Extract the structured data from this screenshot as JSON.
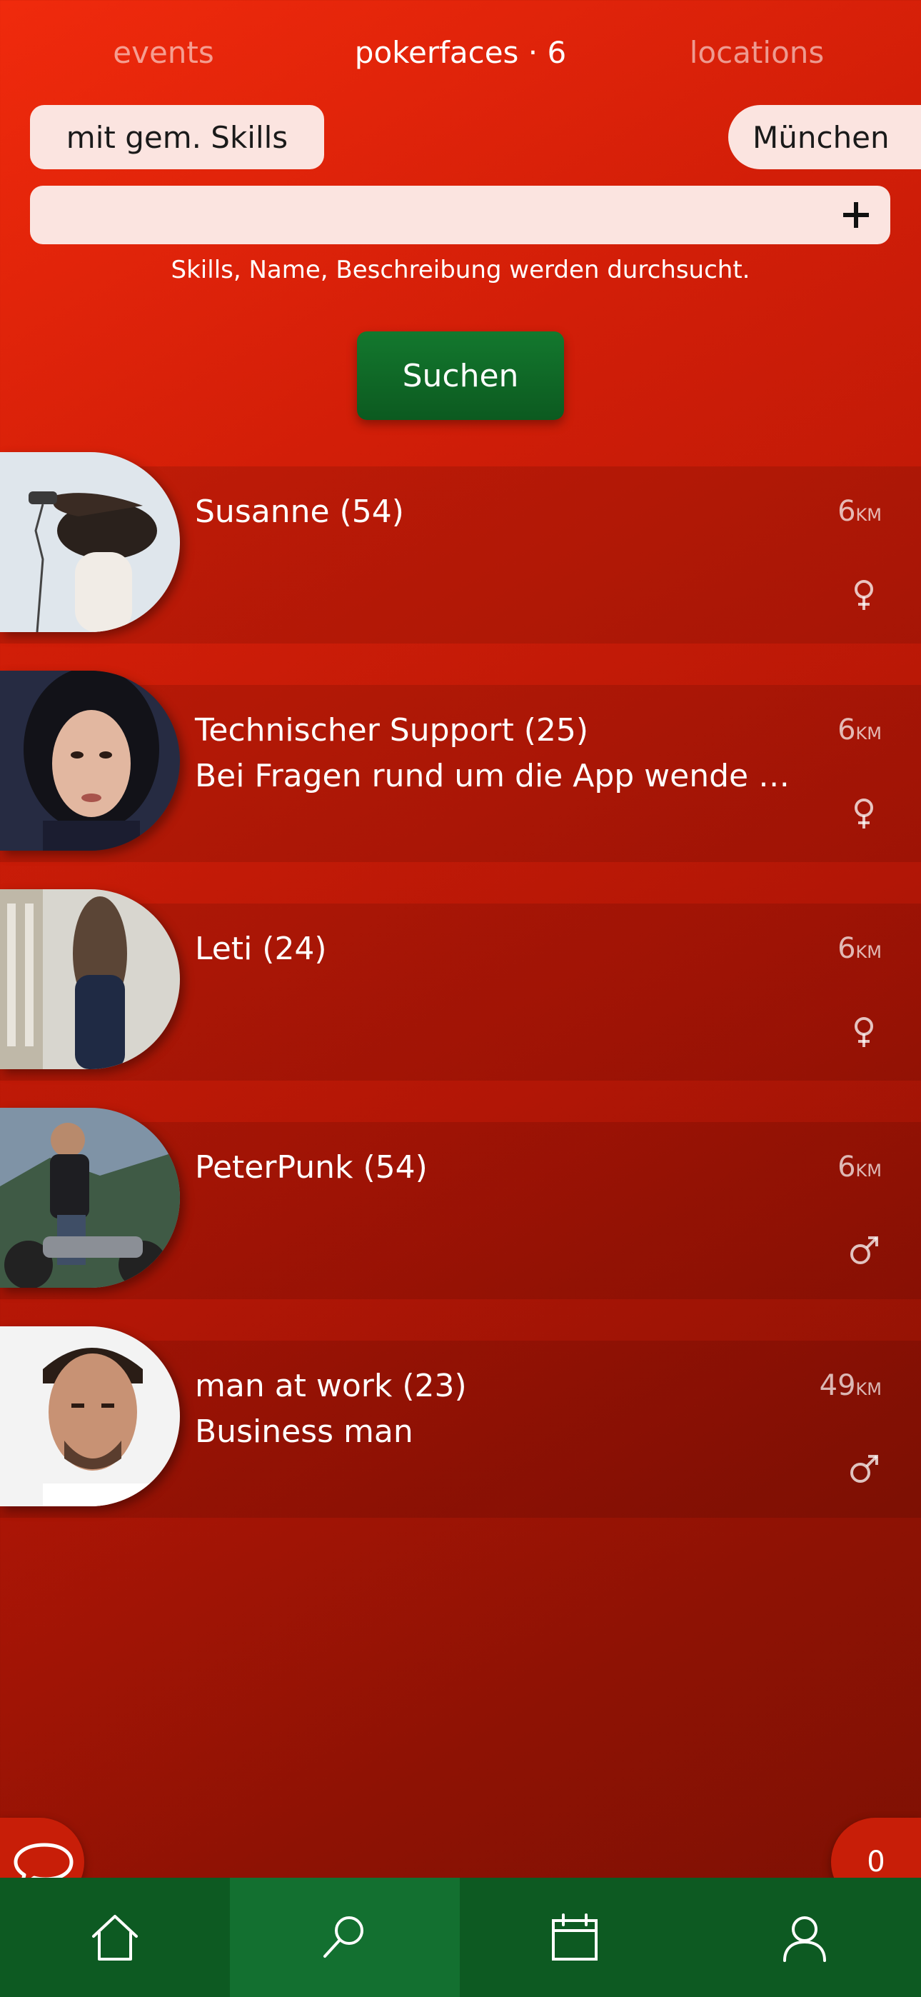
{
  "tabs": [
    {
      "label": "events",
      "active": false
    },
    {
      "label": "pokerfaces · 6",
      "active": true
    },
    {
      "label": "locations",
      "active": false
    }
  ],
  "filters": {
    "skills_label": "mit gem. Skills",
    "city_label": "München"
  },
  "search": {
    "value": "",
    "placeholder": "",
    "add_icon": "plus-icon",
    "hint": "Skills, Name, Beschreibung werden durchsucht.",
    "button_label": "Suchen"
  },
  "results": [
    {
      "name": "Susanne (54)",
      "description": "",
      "distance": "6",
      "unit": "KM",
      "gender": "female-icon",
      "photo": "woman-with-hair-dryer"
    },
    {
      "name": "Technischer Support (25)",
      "description": "Bei Fragen rund um die App wende D...",
      "distance": "6",
      "unit": "KM",
      "gender": "female-icon",
      "photo": "woman-dark-hair-portrait"
    },
    {
      "name": "Leti (24)",
      "description": "",
      "distance": "6",
      "unit": "KM",
      "gender": "female-icon",
      "photo": "woman-walking-back-view"
    },
    {
      "name": "PeterPunk (54)",
      "description": "",
      "distance": "6",
      "unit": "KM",
      "gender": "male-icon",
      "photo": "man-on-motorcycle"
    },
    {
      "name": "man at work (23)",
      "description": "Business man",
      "distance": "49",
      "unit": "KM",
      "gender": "male-icon",
      "photo": "man-portrait"
    }
  ],
  "fabs": {
    "chat_icon": "chat-bubble-icon",
    "count": "0"
  },
  "bottom_nav": [
    {
      "icon": "home-icon",
      "active": false
    },
    {
      "icon": "search-icon",
      "active": true
    },
    {
      "icon": "calendar-icon",
      "active": false
    },
    {
      "icon": "user-icon",
      "active": false
    }
  ],
  "colors": {
    "background_top": "#f02a0c",
    "background_bottom": "#7a1003",
    "primary_button": "#0c5a20",
    "nav_background": "#0d5a22",
    "nav_active": "#137030",
    "pill_background": "#fbe4e0"
  }
}
